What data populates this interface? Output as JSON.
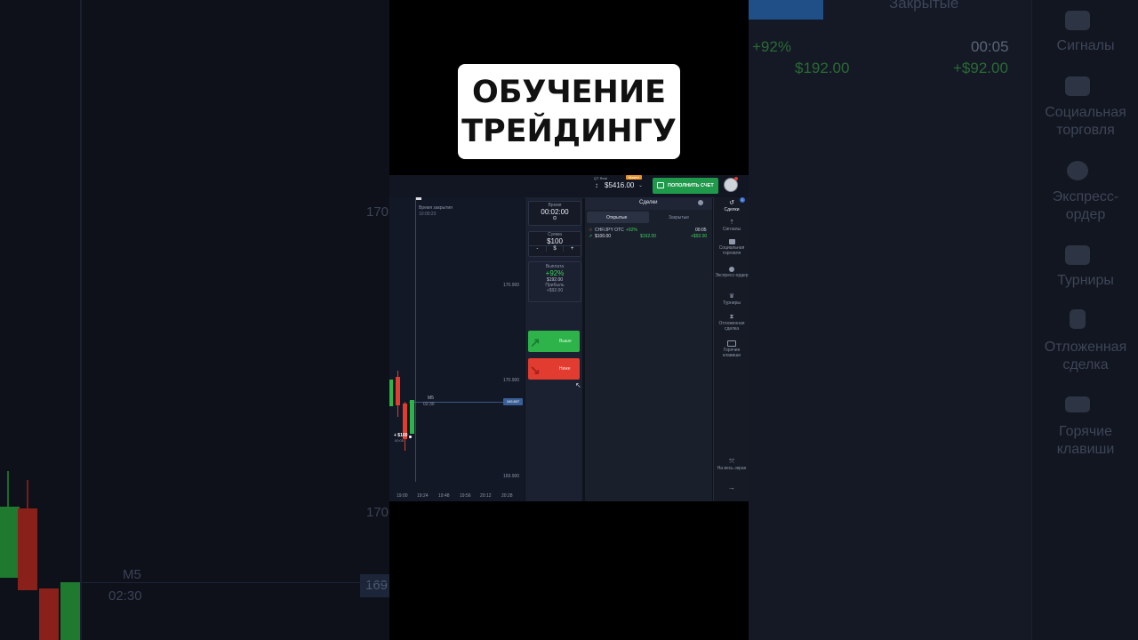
{
  "title": {
    "line1": "ОБУЧЕНИЕ",
    "line2": "ТРЕЙДИНГУ"
  },
  "topbar": {
    "account_label": "QT Real",
    "badge": "Master",
    "balance": "$5416.00",
    "deposit_button": "ПОПОЛНИТЬ СЧЕТ"
  },
  "chart": {
    "close_label": "Время закрытия",
    "close_time": "10:00:23",
    "price_levels": [
      "170.900",
      "170.900",
      "169.900"
    ],
    "timeframe": "M5",
    "timeframe_timer": "02:30",
    "price_tag": "169.807",
    "trade_marker": "+ $100",
    "trade_marker_time": "00:05",
    "time_ticks": [
      "19:00",
      "19:24",
      "19:48",
      "19:56",
      "20:12",
      "20:28"
    ]
  },
  "trade_panel": {
    "time_label": "Время",
    "time_value": "00:02:00",
    "amount_label": "Сумма",
    "amount_value": "$100",
    "minus": "-",
    "currency": "$",
    "plus": "+",
    "payout_label": "Выплата",
    "payout_percent": "+92%",
    "payout_amount": "$192.00",
    "profit_label": "Прибыль",
    "profit_value": "+$92.00",
    "up_label": "Выше",
    "down_label": "Ниже"
  },
  "deals": {
    "title": "Сделки",
    "tabs": [
      "Открытые",
      "Закрытые"
    ],
    "row": {
      "pair": "CHF/JPY OTC",
      "percent": "+92%",
      "timer": "00:05",
      "amount": "$100.00",
      "payout": "$192.00",
      "profit": "+$92.00"
    }
  },
  "sidebar": {
    "badge": "1",
    "items": [
      "Сделки",
      "Сигналы",
      "Социальная торговля",
      "Экспресс-ордер",
      "Турниры",
      "Отложенная сделка",
      "Горячие клавиши"
    ],
    "fullscreen": "На весь экран"
  },
  "background": {
    "left_price": "170",
    "left_price2": "170",
    "left_tf": "M5",
    "left_timer": "02:30",
    "left_tag": "169",
    "right_tab": "Закрытые",
    "right_percent": "+92%",
    "right_timer": "00:05",
    "right_payout": "$192.00",
    "right_profit": "+$92.00",
    "right_items": [
      "Сигналы",
      "Социальная торговля",
      "Экспресс-ордер",
      "Турниры",
      "Отложенная сделка",
      "Горячие клавиши"
    ]
  },
  "colors": {
    "up": "#2db34a",
    "down": "#e23b2f",
    "deposit": "#1f9a4a",
    "accent": "#4a7fd1"
  }
}
